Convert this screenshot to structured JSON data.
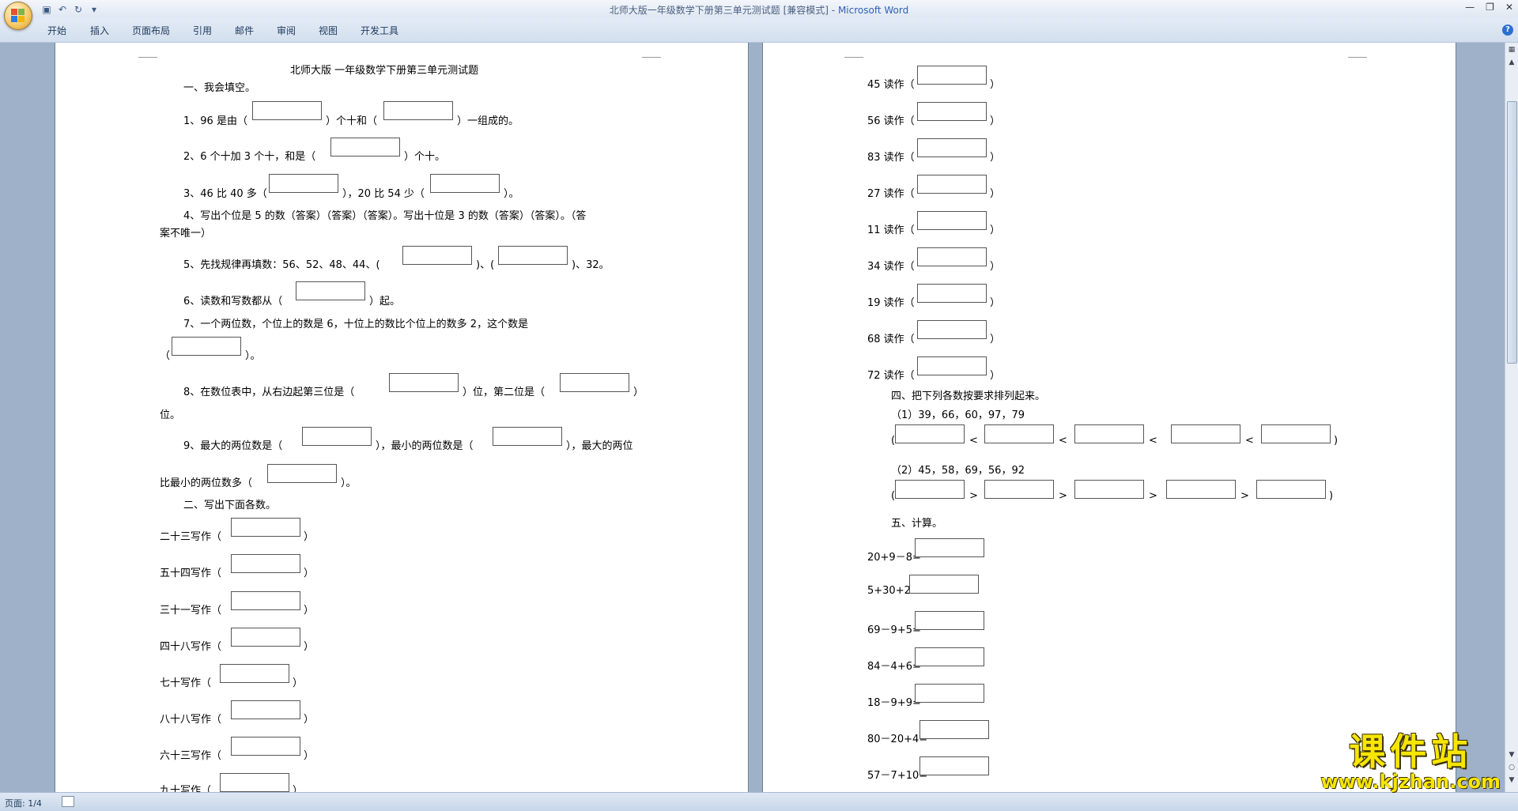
{
  "window": {
    "title": "北师大版一年级数学下册第三单元测试题 [兼容模式]",
    "app_name": "Microsoft Word",
    "separator": " - "
  },
  "ribbon": {
    "tabs": [
      "开始",
      "插入",
      "页面布局",
      "引用",
      "邮件",
      "审阅",
      "视图",
      "开发工具"
    ]
  },
  "left_page": {
    "title": "北师大版  一年级数学下册第三单元测试题",
    "s1": "一、我会填空。",
    "q1a": "1、96 是由（",
    "q1b": "）个十和（",
    "q1c": "）一组成的。",
    "q2a": "2、6 个十加 3 个十，和是（",
    "q2b": "）个十。",
    "q3a": "3、46 比 40 多（",
    "q3b": "），20 比 54 少（",
    "q3c": "）。",
    "q4a": "4、写出个位是 5 的数（答案）（答案）（答案）。写出十位是 3 的数（答案）（答案）。（答",
    "q4b": "案不唯一）",
    "q5a": "5、先找规律再填数：56、52、48、44、(",
    "q5b": ")、(",
    "q5c": ")、32。",
    "q6a": "6、读数和写数都从（",
    "q6b": "）起。",
    "q7a": "7、一个两位数，个位上的数是  6，十位上的数比个位上的数多  2，这个数是",
    "q7b": "（",
    "q7c": "）。",
    "q8a": "8、在数位表中，从右边起第三位是（",
    "q8b": "）位，第二位是（",
    "q8c": "）",
    "q8d": "位。",
    "q9a": "9、最大的两位数是（",
    "q9b": "），最小的两位数是（",
    "q9c": "），最大的两位",
    "q9d": "比最小的两位数多（",
    "q9e": "）。",
    "s2": "二、写出下面各数。",
    "write_items": [
      {
        "label": "二十三写作（",
        "end": "）"
      },
      {
        "label": "五十四写作（",
        "end": "）"
      },
      {
        "label": "三十一写作（",
        "end": "）"
      },
      {
        "label": "四十八写作（",
        "end": "）"
      },
      {
        "label": "七十写作（",
        "end": "）"
      },
      {
        "label": "八十八写作（",
        "end": "）"
      },
      {
        "label": "六十三写作（",
        "end": "）"
      },
      {
        "label": "九十写作（",
        "end": "）"
      }
    ]
  },
  "right_page": {
    "read_items": [
      {
        "label": "45 读作（",
        "end": "）"
      },
      {
        "label": "56 读作（",
        "end": "）"
      },
      {
        "label": "83 读作（",
        "end": "）"
      },
      {
        "label": "27 读作（",
        "end": "）"
      },
      {
        "label": "11 读作（",
        "end": "）"
      },
      {
        "label": "34 读作（",
        "end": "）"
      },
      {
        "label": "19 读作（",
        "end": "）"
      },
      {
        "label": "68 读作（",
        "end": "）"
      },
      {
        "label": "72 读作（",
        "end": "）"
      }
    ],
    "s4": "四、把下列各数按要求排列起来。",
    "o1": "（1）39，66，60，97，79",
    "o2": "（2）45，58，69，56，92",
    "lt": "<",
    "gt": ">",
    "s5": "五、计算。",
    "calc_items": [
      "20+9－8=",
      "5+30+2=",
      "69－9+5=",
      "84－4+6=",
      "18－9+9=",
      "80－20+4=",
      "57－7+10="
    ]
  },
  "status": {
    "page": "页面: 1/4"
  },
  "watermark": {
    "cn": "课件站",
    "url": "www.kjzhan.com"
  }
}
